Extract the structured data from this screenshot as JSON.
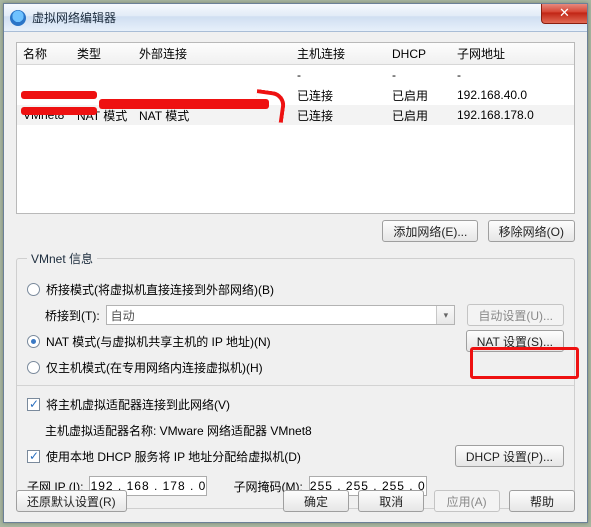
{
  "window": {
    "title": "虚拟网络编辑器",
    "close_glyph": "✕"
  },
  "table": {
    "headers": {
      "name": "名称",
      "type": "类型",
      "ext": "外部连接",
      "host": "主机连接",
      "dhcp": "DHCP",
      "subnet": "子网地址"
    },
    "rows": [
      {
        "name": "",
        "type": "",
        "ext": "",
        "host": "-",
        "dhcp": "-",
        "subnet": "-"
      },
      {
        "name": "",
        "type": "",
        "ext": "",
        "host": "已连接",
        "dhcp": "已启用",
        "subnet": "192.168.40.0"
      },
      {
        "name": "VMnet8",
        "type": "NAT 模式",
        "ext": "NAT 模式",
        "host": "已连接",
        "dhcp": "已启用",
        "subnet": "192.168.178.0"
      }
    ]
  },
  "buttons": {
    "add_net": "添加网络(E)...",
    "remove_net": "移除网络(O)",
    "auto_set": "自动设置(U)...",
    "nat_set": "NAT 设置(S)...",
    "dhcp_set": "DHCP 设置(P)...",
    "restore": "还原默认设置(R)",
    "ok": "确定",
    "cancel": "取消",
    "apply": "应用(A)",
    "help": "帮助"
  },
  "group": {
    "legend": "VMnet 信息",
    "bridge_radio": "桥接模式(将虚拟机直接连接到外部网络)(B)",
    "bridge_to_label": "桥接到(T):",
    "bridge_to_value": "自动",
    "nat_radio": "NAT 模式(与虚拟机共享主机的 IP 地址)(N)",
    "hostonly_radio": "仅主机模式(在专用网络内连接虚拟机)(H)",
    "connect_host_check": "将主机虚拟适配器连接到此网络(V)",
    "adapter_label": "主机虚拟适配器名称: VMware 网络适配器 VMnet8",
    "use_dhcp_check": "使用本地 DHCP 服务将 IP 地址分配给虚拟机(D)",
    "subnet_ip_label": "子网 IP (I):",
    "subnet_ip_value": "192 . 168 . 178 .  0",
    "subnet_mask_label": "子网掩码(M):",
    "subnet_mask_value": "255 . 255 . 255 .  0"
  }
}
